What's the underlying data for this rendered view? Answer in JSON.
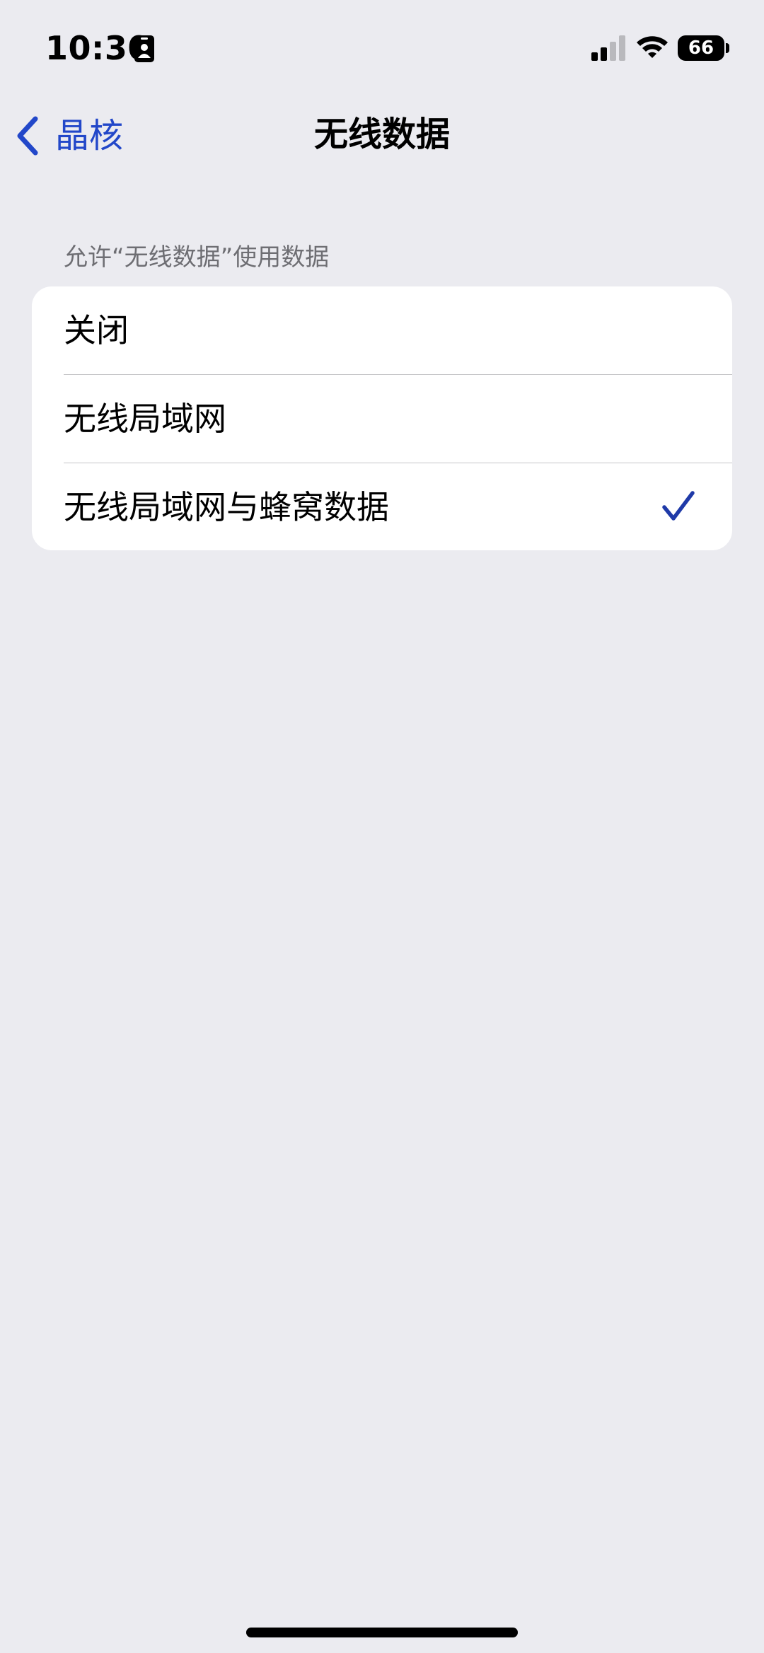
{
  "status_bar": {
    "time": "10:30",
    "battery_level": "66",
    "icons": [
      "id-badge-icon",
      "signal-icon",
      "wifi-icon",
      "battery-icon"
    ],
    "signal_bars_active": 2,
    "signal_bars_total": 4
  },
  "nav": {
    "back_label": "晶核",
    "title": "无线数据",
    "accent_color": "#2247c9"
  },
  "section": {
    "header": "允许“无线数据”使用数据",
    "options": [
      {
        "label": "关闭",
        "selected": false
      },
      {
        "label": "无线局域网",
        "selected": false
      },
      {
        "label": "无线局域网与蜂窝数据",
        "selected": true
      }
    ]
  },
  "colors": {
    "background": "#ebebf0",
    "card": "#ffffff",
    "separator": "#c6c6c8",
    "secondary_text": "#6e6e73",
    "checkmark": "#1f3aa8"
  }
}
